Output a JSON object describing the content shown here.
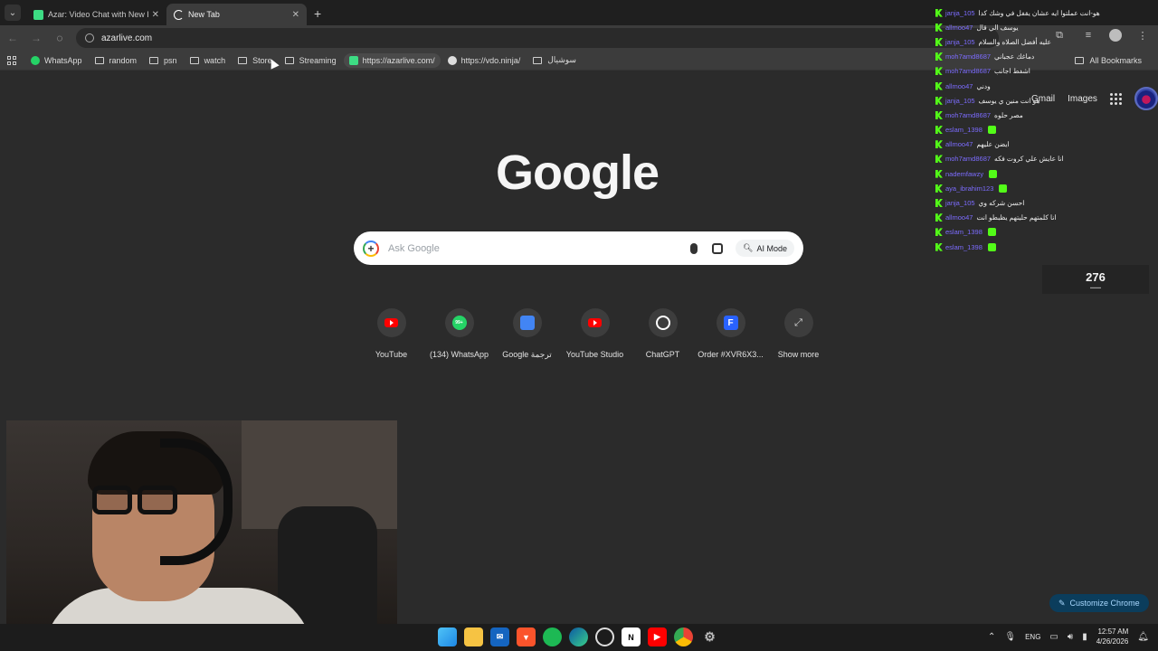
{
  "tabs": [
    {
      "title": "Azar: Video Chat with New People",
      "favicon_color": "#3ddc84",
      "active": false
    },
    {
      "title": "New Tab",
      "favicon_color": "#ffffff",
      "active": true
    }
  ],
  "toolbar": {
    "url": "azarlive.com",
    "icons": [
      "back-icon",
      "forward-icon",
      "stop-icon",
      "tune-icon",
      "star-icon",
      "extensions-icon",
      "media-icon",
      "profile-icon",
      "menu-icon"
    ]
  },
  "bookmarks": {
    "items": [
      {
        "label": "WhatsApp",
        "type": "site"
      },
      {
        "label": "random",
        "type": "folder"
      },
      {
        "label": "psn",
        "type": "folder"
      },
      {
        "label": "watch",
        "type": "folder"
      },
      {
        "label": "Store",
        "type": "folder"
      },
      {
        "label": "Streaming",
        "type": "folder"
      },
      {
        "label": "https://azarlive.com/",
        "type": "site"
      },
      {
        "label": "https://vdo.ninja/",
        "type": "site"
      },
      {
        "label": "سوشيال",
        "type": "folder"
      }
    ],
    "all_label": "All Bookmarks"
  },
  "page": {
    "gmail": "Gmail",
    "images": "Images",
    "logo": "Google",
    "search_placeholder": "Ask Google",
    "ai_mode": "AI Mode",
    "customize": "Customize Chrome"
  },
  "shortcuts": [
    {
      "label": "YouTube",
      "icon": "youtube-icon"
    },
    {
      "label": "(134) WhatsApp",
      "icon": "whatsapp-icon",
      "badge": "99+"
    },
    {
      "label": "Google ترجمة",
      "icon": "translate-icon"
    },
    {
      "label": "YouTube Studio",
      "icon": "youtube-studio-icon"
    },
    {
      "label": "ChatGPT",
      "icon": "chatgpt-icon"
    },
    {
      "label": "Order #XVR6X3...",
      "icon": "f-icon"
    },
    {
      "label": "Show more",
      "icon": "expand-icon"
    }
  ],
  "chat": [
    {
      "user": "janja_105",
      "msg": "هو-انت عملتوا ايه عشان يقفل في وشك كدا"
    },
    {
      "user": "allmoo47",
      "msg": "يوسف الي قال"
    },
    {
      "user": "janja_105",
      "msg": "عليه أفضل الصلاه والسلام"
    },
    {
      "user": "moh7amd8687",
      "msg": "دماغك عجباني"
    },
    {
      "user": "moh7amd8687",
      "msg": "اشفط اجانب"
    },
    {
      "user": "allmoo47",
      "msg": "ودني"
    },
    {
      "user": "janja_105",
      "msg": "هو انت منين ي يوسف"
    },
    {
      "user": "moh7amd8687",
      "msg": "مصر حلوه"
    },
    {
      "user": "eslam_1398",
      "msg": ""
    },
    {
      "user": "allmoo47",
      "msg": "ايضن عليهم"
    },
    {
      "user": "moh7amd8687",
      "msg": "انا عايش علي كروت فكه"
    },
    {
      "user": "nademfawzy",
      "msg": ""
    },
    {
      "user": "aya_ibrahim123",
      "msg": ""
    },
    {
      "user": "janja_105",
      "msg": "احسن شركه وي"
    },
    {
      "user": "allmoo47",
      "msg": "انا كلمتهم حليتهم يظبطو انت"
    },
    {
      "user": "eslam_1398",
      "msg": ""
    },
    {
      "user": "eslam_1398",
      "msg": ""
    }
  ],
  "viewers": {
    "count": "276"
  },
  "taskbar": {
    "apps": [
      "windows-icon",
      "file-explorer-icon",
      "mail-icon",
      "brave-icon",
      "spotify-icon",
      "edge-icon",
      "chatgpt-app-icon",
      "notion-icon",
      "youtube-app-icon",
      "chrome-icon",
      "settings-icon"
    ],
    "lang": "ENG",
    "time": "12:57 AM",
    "date": "4/26/2026"
  }
}
